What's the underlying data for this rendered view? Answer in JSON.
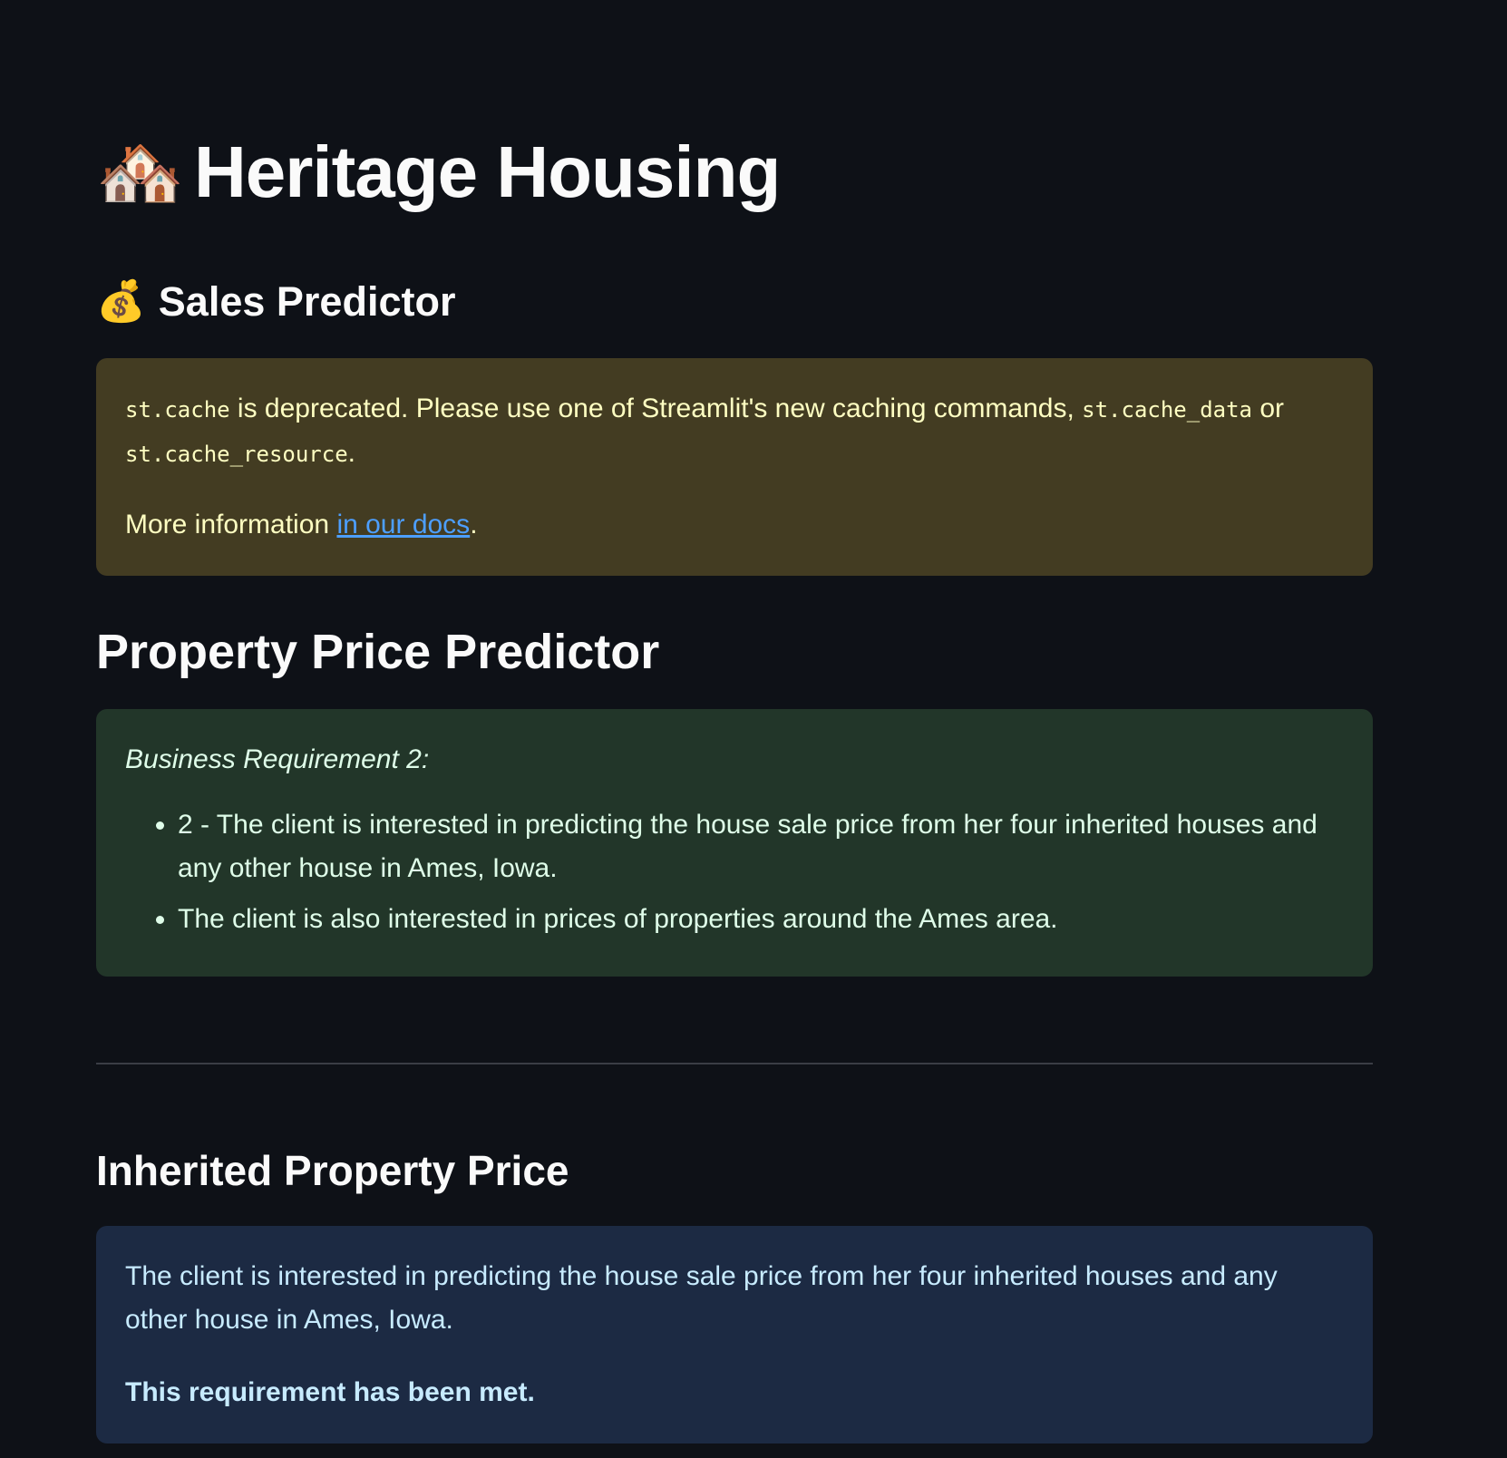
{
  "header": {
    "title_emoji": "🏘️",
    "title": "Heritage Housing",
    "subtitle_emoji": "💰",
    "subtitle": "Sales Predictor"
  },
  "warning": {
    "code_1": "st.cache",
    "text_1": " is deprecated. Please use one of Streamlit's new caching commands, ",
    "code_2": "st.cache_data",
    "text_2": " or ",
    "code_3": "st.cache_resource",
    "text_3": ".",
    "more_info_prefix": "More information ",
    "link_text": "in our docs",
    "more_info_suffix": "."
  },
  "price_section": {
    "heading": "Property Price Predictor",
    "requirement_title": "Business Requirement 2:",
    "bullets": [
      "2 - The client is interested in predicting the house sale price from her four inherited houses and any other house in Ames, Iowa.",
      "The client is also interested in prices of properties around the Ames area."
    ]
  },
  "inherited_section": {
    "heading": "Inherited Property Price",
    "description": "The client is interested in predicting the house sale price from her four inherited houses and any other house in Ames, Iowa.",
    "status": "This requirement has been met."
  },
  "colors": {
    "background": "#0e1117",
    "warning_bg": "#433c22",
    "success_bg": "#223629",
    "info_bg": "#1c2a43",
    "link": "#4d9fff"
  }
}
